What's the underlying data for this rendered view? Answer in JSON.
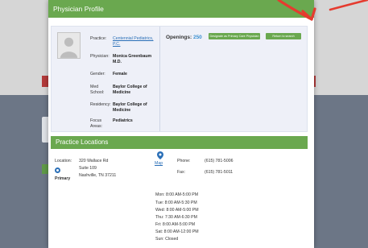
{
  "modal": {
    "title": "Physician Profile",
    "profile": {
      "practice_label": "Practice:",
      "practice_value": "Centennial Pediatrics, P.C.",
      "physician_label": "Physician:",
      "physician_value": "Monica Greenbaum M.D.",
      "gender_label": "Gender:",
      "gender_value": "Female",
      "medschool_label": "Med School:",
      "medschool_value": "Baylor College of Medicine",
      "residency_label": "Residency:",
      "residency_value": "Baylor College of Medicine",
      "focus_label": "Focus Areas:",
      "focus_value": "Pediatrics"
    },
    "openings_label": "Openings:",
    "openings_value": "250",
    "buttons": {
      "designate": "Designate as Primary Care Physician",
      "return": "Return to search"
    },
    "locations": {
      "title": "Practice Locations",
      "location_label": "Location:",
      "address_line1": "320 Wallace Rd",
      "address_line2": "Suite 109",
      "address_line3": "Nashville, TN 37211",
      "primary_label": "Primary",
      "map_label": "Map",
      "phone_label": "Phone:",
      "phone_value": "(615) 781-5006",
      "fax_label": "Fax:",
      "fax_value": "(615) 781-5011",
      "hours": [
        "Mon: 8:00 AM-5:00 PM",
        "Tue: 8:00 AM-5:30 PM",
        "Wed: 8:00 AM-5:00 PM",
        "Thu: 7:30 AM-6:30 PM",
        "Fri: 8:00 AM-5:00 PM",
        "Sat: 8:00 AM-12:00 PM",
        "Sun: Closed"
      ]
    }
  },
  "colors": {
    "header_green": "#6aa84f",
    "annotation_red": "#e53b2f",
    "link_blue": "#2a6fb7"
  }
}
